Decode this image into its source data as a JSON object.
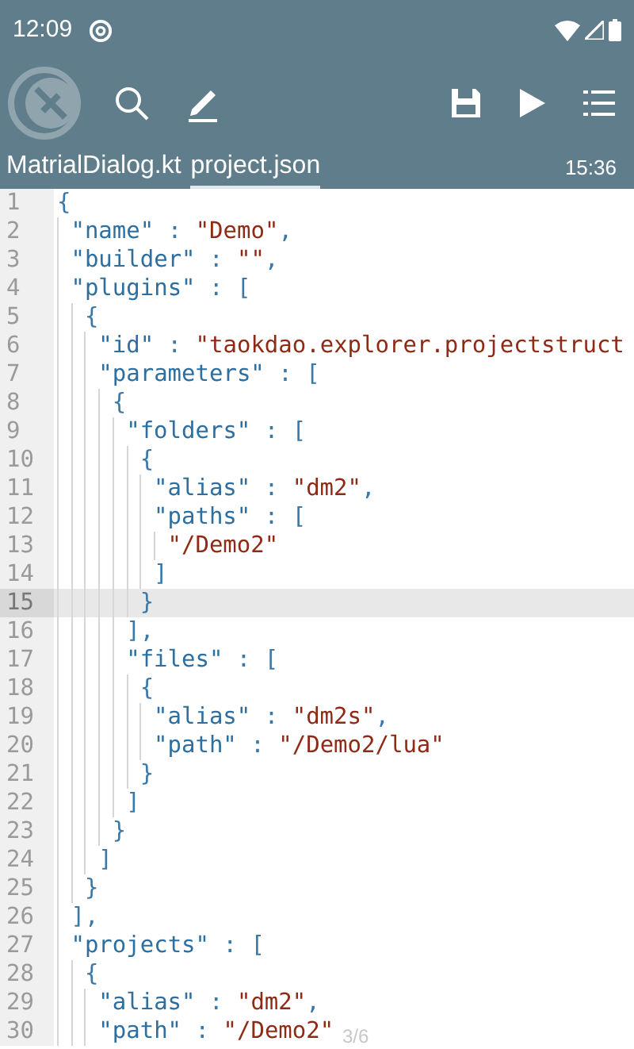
{
  "status_bar": {
    "time": "12:09"
  },
  "tabs": [
    {
      "label": "MatrialDialog.kt",
      "selected": false
    },
    {
      "label": "project.json",
      "selected": true
    }
  ],
  "clock": "15:36",
  "editor": {
    "lines": [
      {
        "number": "1",
        "current": false,
        "tokens": [
          {
            "kind": "punct",
            "text": "{"
          }
        ]
      },
      {
        "number": "2",
        "current": false,
        "tokens": [
          {
            "kind": "key",
            "text": " \"name\""
          },
          {
            "kind": "punct",
            "text": " : "
          },
          {
            "kind": "string",
            "text": "\"Demo\""
          },
          {
            "kind": "punct",
            "text": ","
          }
        ]
      },
      {
        "number": "3",
        "current": false,
        "tokens": [
          {
            "kind": "key",
            "text": " \"builder\""
          },
          {
            "kind": "punct",
            "text": " : "
          },
          {
            "kind": "string",
            "text": "\"\""
          },
          {
            "kind": "punct",
            "text": ","
          }
        ]
      },
      {
        "number": "4",
        "current": false,
        "tokens": [
          {
            "kind": "key",
            "text": " \"plugins\""
          },
          {
            "kind": "punct",
            "text": " : ["
          }
        ]
      },
      {
        "number": "5",
        "current": false,
        "tokens": [
          {
            "kind": "punct",
            "text": "  {"
          }
        ]
      },
      {
        "number": "6",
        "current": false,
        "tokens": [
          {
            "kind": "key",
            "text": "   \"id\""
          },
          {
            "kind": "punct",
            "text": " : "
          },
          {
            "kind": "string",
            "text": "\"taokdao.explorer.projectstruct"
          }
        ]
      },
      {
        "number": "7",
        "current": false,
        "tokens": [
          {
            "kind": "key",
            "text": "   \"parameters\""
          },
          {
            "kind": "punct",
            "text": " : ["
          }
        ]
      },
      {
        "number": "8",
        "current": false,
        "tokens": [
          {
            "kind": "punct",
            "text": "    {"
          }
        ]
      },
      {
        "number": "9",
        "current": false,
        "tokens": [
          {
            "kind": "key",
            "text": "     \"folders\""
          },
          {
            "kind": "punct",
            "text": " : ["
          }
        ]
      },
      {
        "number": "10",
        "current": false,
        "tokens": [
          {
            "kind": "punct",
            "text": "      {"
          }
        ]
      },
      {
        "number": "11",
        "current": false,
        "tokens": [
          {
            "kind": "key",
            "text": "       \"alias\""
          },
          {
            "kind": "punct",
            "text": " : "
          },
          {
            "kind": "string",
            "text": "\"dm2\""
          },
          {
            "kind": "punct",
            "text": ","
          }
        ]
      },
      {
        "number": "12",
        "current": false,
        "tokens": [
          {
            "kind": "key",
            "text": "       \"paths\""
          },
          {
            "kind": "punct",
            "text": " : ["
          }
        ]
      },
      {
        "number": "13",
        "current": false,
        "tokens": [
          {
            "kind": "string",
            "text": "        \"/Demo2\""
          }
        ]
      },
      {
        "number": "14",
        "current": false,
        "tokens": [
          {
            "kind": "punct",
            "text": "       ]"
          }
        ]
      },
      {
        "number": "15",
        "current": true,
        "tokens": [
          {
            "kind": "punct",
            "text": "      }"
          }
        ]
      },
      {
        "number": "16",
        "current": false,
        "tokens": [
          {
            "kind": "punct",
            "text": "     ],"
          }
        ]
      },
      {
        "number": "17",
        "current": false,
        "tokens": [
          {
            "kind": "key",
            "text": "     \"files\""
          },
          {
            "kind": "punct",
            "text": " : ["
          }
        ]
      },
      {
        "number": "18",
        "current": false,
        "tokens": [
          {
            "kind": "punct",
            "text": "      {"
          }
        ]
      },
      {
        "number": "19",
        "current": false,
        "tokens": [
          {
            "kind": "key",
            "text": "       \"alias\""
          },
          {
            "kind": "punct",
            "text": " : "
          },
          {
            "kind": "string",
            "text": "\"dm2s\""
          },
          {
            "kind": "punct",
            "text": ","
          }
        ]
      },
      {
        "number": "20",
        "current": false,
        "tokens": [
          {
            "kind": "key",
            "text": "       \"path\""
          },
          {
            "kind": "punct",
            "text": " : "
          },
          {
            "kind": "string",
            "text": "\"/Demo2/lua\""
          }
        ]
      },
      {
        "number": "21",
        "current": false,
        "tokens": [
          {
            "kind": "punct",
            "text": "      }"
          }
        ]
      },
      {
        "number": "22",
        "current": false,
        "tokens": [
          {
            "kind": "punct",
            "text": "     ]"
          }
        ]
      },
      {
        "number": "23",
        "current": false,
        "tokens": [
          {
            "kind": "punct",
            "text": "    }"
          }
        ]
      },
      {
        "number": "24",
        "current": false,
        "tokens": [
          {
            "kind": "punct",
            "text": "   ]"
          }
        ]
      },
      {
        "number": "25",
        "current": false,
        "tokens": [
          {
            "kind": "punct",
            "text": "  }"
          }
        ]
      },
      {
        "number": "26",
        "current": false,
        "tokens": [
          {
            "kind": "punct",
            "text": " ],"
          }
        ]
      },
      {
        "number": "27",
        "current": false,
        "tokens": [
          {
            "kind": "key",
            "text": " \"projects\""
          },
          {
            "kind": "punct",
            "text": " : ["
          }
        ]
      },
      {
        "number": "28",
        "current": false,
        "tokens": [
          {
            "kind": "punct",
            "text": "  {"
          }
        ]
      },
      {
        "number": "29",
        "current": false,
        "tokens": [
          {
            "kind": "key",
            "text": "   \"alias\""
          },
          {
            "kind": "punct",
            "text": " : "
          },
          {
            "kind": "string",
            "text": "\"dm2\""
          },
          {
            "kind": "punct",
            "text": ","
          }
        ]
      },
      {
        "number": "30",
        "current": false,
        "tokens": [
          {
            "kind": "key",
            "text": "   \"path\""
          },
          {
            "kind": "punct",
            "text": " : "
          },
          {
            "kind": "string",
            "text": "\"/Demo2\""
          }
        ]
      }
    ],
    "page_indicator": "3/6"
  }
}
